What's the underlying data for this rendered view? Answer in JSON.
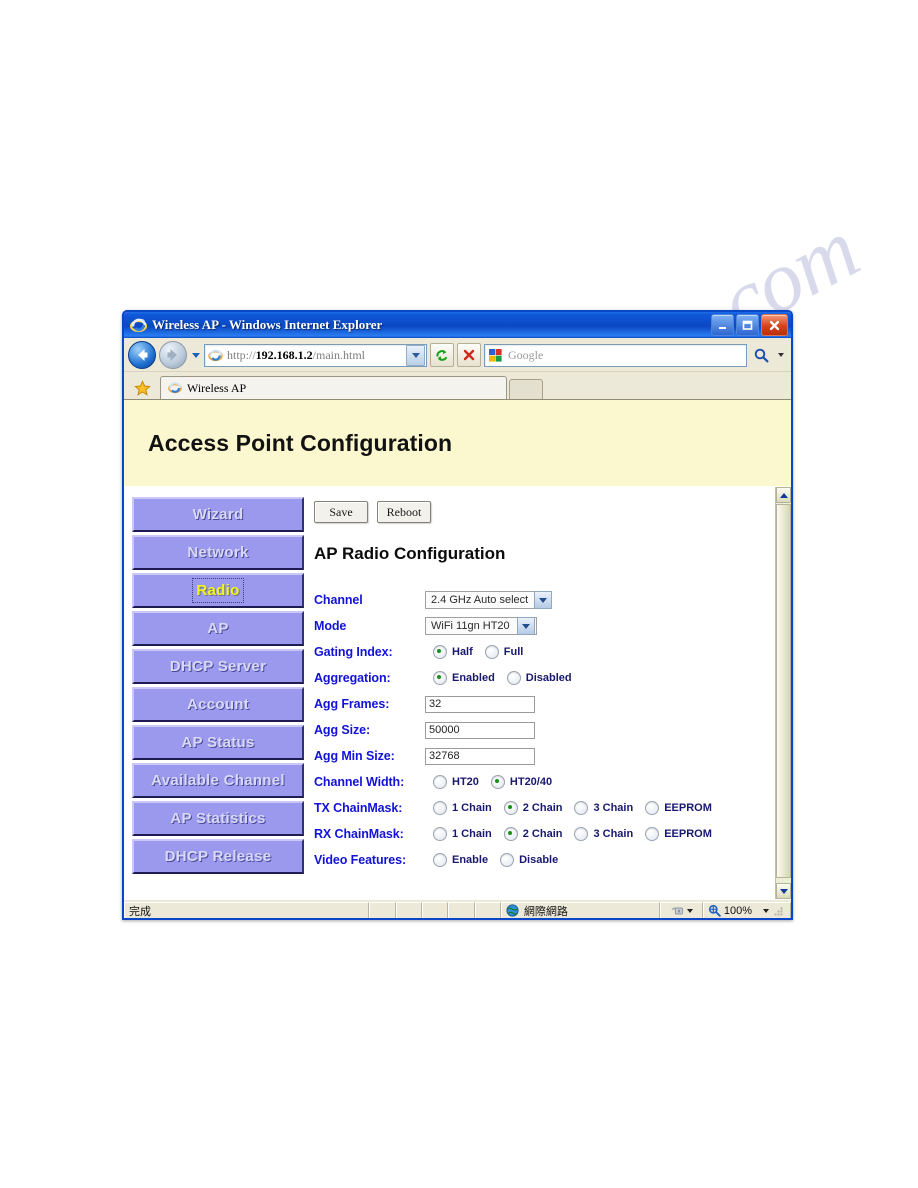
{
  "window": {
    "title": "Wireless AP - Windows Internet Explorer",
    "minimize_label": "Minimize",
    "maximize_label": "Maximize",
    "close_label": "Close"
  },
  "toolbar": {
    "back_label": "Back",
    "forward_label": "Forward",
    "recent_pages_label": "Recent Pages",
    "url": "http://192.168.1.2/main.html",
    "url_scheme": "http://",
    "url_host": "192.168.1.2",
    "url_path": "/main.html",
    "address_dropdown_label": "Address dropdown",
    "refresh_label": "Refresh",
    "stop_label": "Stop",
    "search_placeholder": "Google",
    "search_go_label": "Search",
    "search_dropdown_label": "Search options"
  },
  "tabs": {
    "favorites_label": "Favorites Center",
    "items": [
      {
        "label": "Wireless AP"
      }
    ],
    "new_tab_label": "New Tab"
  },
  "page": {
    "banner_title": "Access Point Configuration",
    "banner_color": "#fbf8cf"
  },
  "menu": {
    "items": [
      {
        "label": "Wizard",
        "active": false
      },
      {
        "label": "Network",
        "active": false
      },
      {
        "label": "Radio",
        "active": true
      },
      {
        "label": "AP",
        "active": false
      },
      {
        "label": "DHCP Server",
        "active": false
      },
      {
        "label": "Account",
        "active": false
      },
      {
        "label": "AP Status",
        "active": false
      },
      {
        "label": "Available Channel",
        "active": false
      },
      {
        "label": "AP Statistics",
        "active": false
      },
      {
        "label": "DHCP Release",
        "active": false
      }
    ],
    "button_color": "#9a99ee",
    "active_text_color": "#f2f718"
  },
  "form": {
    "save_label": "Save",
    "reboot_label": "Reboot",
    "heading": "AP Radio Configuration",
    "label_color": "#1212d8",
    "fields": [
      {
        "name": "channel",
        "label": "Channel",
        "type": "select",
        "value": "2.4 GHz Auto select"
      },
      {
        "name": "mode",
        "label": "Mode",
        "type": "select",
        "value": "WiFi 11gn HT20"
      },
      {
        "name": "gating_index",
        "label": "Gating Index:",
        "type": "radio",
        "options": [
          {
            "label": "Half",
            "selected": true
          },
          {
            "label": "Full",
            "selected": false
          }
        ]
      },
      {
        "name": "aggregation",
        "label": "Aggregation:",
        "type": "radio",
        "options": [
          {
            "label": "Enabled",
            "selected": true
          },
          {
            "label": "Disabled",
            "selected": false
          }
        ]
      },
      {
        "name": "agg_frames",
        "label": "Agg Frames:",
        "type": "text",
        "value": "32"
      },
      {
        "name": "agg_size",
        "label": "Agg Size:",
        "type": "text",
        "value": "50000"
      },
      {
        "name": "agg_min_size",
        "label": "Agg Min Size:",
        "type": "text",
        "value": "32768"
      },
      {
        "name": "channel_width",
        "label": "Channel Width:",
        "type": "radio",
        "options": [
          {
            "label": "HT20",
            "selected": false
          },
          {
            "label": "HT20/40",
            "selected": true
          }
        ]
      },
      {
        "name": "tx_chainmask",
        "label": "TX ChainMask:",
        "type": "radio",
        "options": [
          {
            "label": "1 Chain",
            "selected": false
          },
          {
            "label": "2 Chain",
            "selected": true
          },
          {
            "label": "3 Chain",
            "selected": false
          },
          {
            "label": "EEPROM",
            "selected": false
          }
        ]
      },
      {
        "name": "rx_chainmask",
        "label": "RX ChainMask:",
        "type": "radio",
        "options": [
          {
            "label": "1 Chain",
            "selected": false
          },
          {
            "label": "2 Chain",
            "selected": true
          },
          {
            "label": "3 Chain",
            "selected": false
          },
          {
            "label": "EEPROM",
            "selected": false
          }
        ]
      },
      {
        "name": "video_features",
        "label": "Video Features:",
        "type": "radio",
        "options": [
          {
            "label": "Enable",
            "selected": false
          },
          {
            "label": "Disable",
            "selected": false
          }
        ]
      }
    ]
  },
  "scrollbar": {
    "up_label": "Scroll up",
    "down_label": "Scroll down",
    "thumb_label": "Scroll thumb"
  },
  "statusbar": {
    "status": "完成",
    "zone": "網際網路",
    "zoom": "100%",
    "security_label": "Protected Mode",
    "resize_label": "Resize"
  }
}
